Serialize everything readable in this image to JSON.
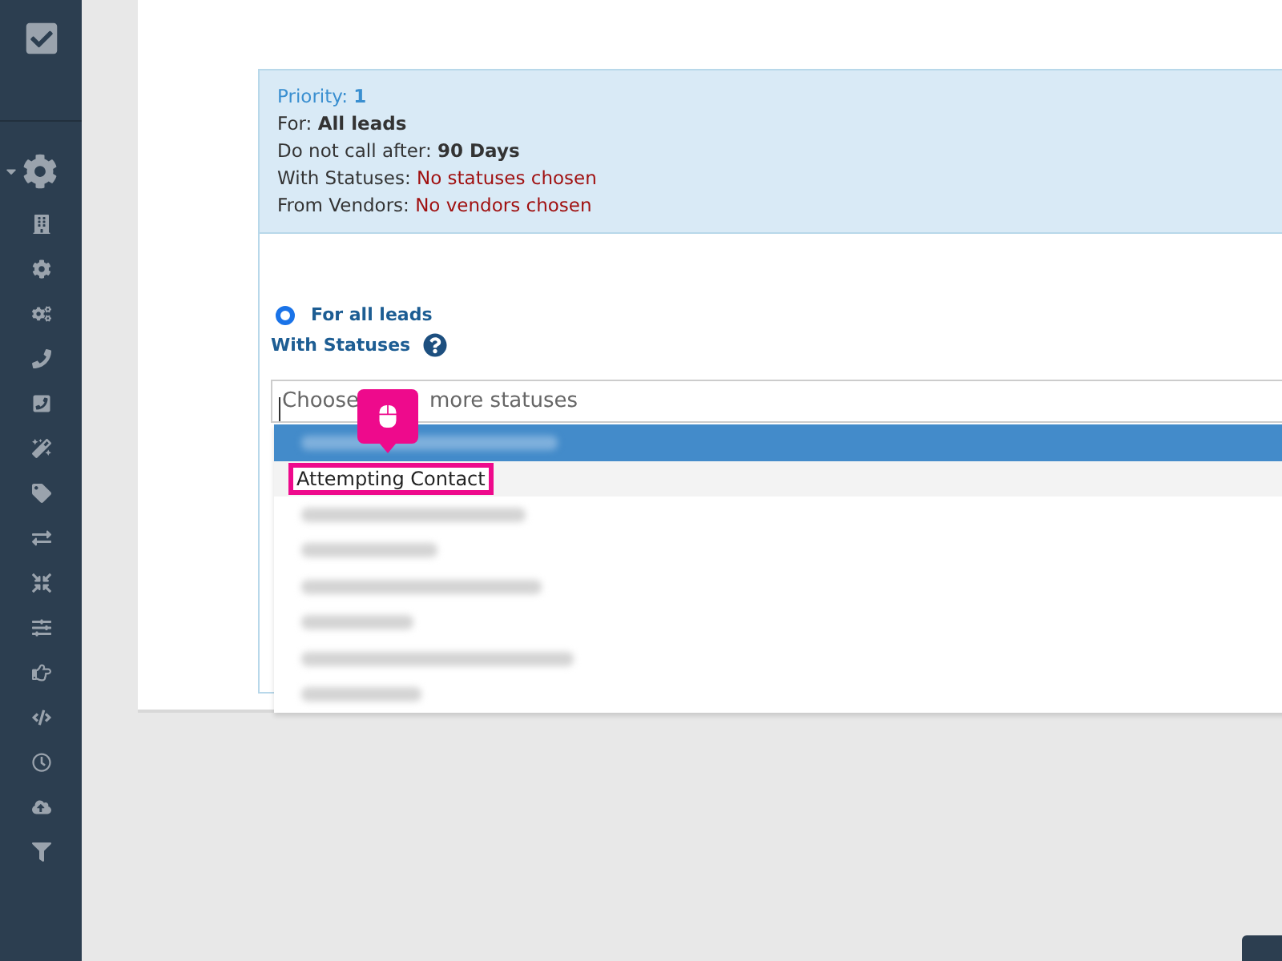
{
  "summary": {
    "priority_label": "Priority:",
    "priority": "1",
    "for_label": "For:",
    "for_value": "All leads",
    "call_label": "Do not call after:",
    "call_value": "90 Days",
    "statuses_label": "With Statuses:",
    "statuses_value": "No statuses chosen",
    "vendors_label": "From Vendors:",
    "vendors_value": "No vendors chosen"
  },
  "radio": {
    "label": "For all leads",
    "selected": true
  },
  "statuses_label": "With Statuses",
  "select": {
    "placeholder_parts": [
      "Choose",
      "more statuses"
    ]
  },
  "options": [
    {
      "kind": "blurred",
      "highlighted": true,
      "hovered": false
    },
    {
      "kind": "text",
      "label": "Attempting Contact",
      "highlighted": false,
      "hovered": true
    },
    {
      "kind": "blurred",
      "highlighted": false,
      "hovered": false
    },
    {
      "kind": "blurred",
      "highlighted": false,
      "hovered": false
    },
    {
      "kind": "blurred",
      "highlighted": false,
      "hovered": false
    },
    {
      "kind": "blurred",
      "highlighted": false,
      "hovered": false
    },
    {
      "kind": "blurred",
      "highlighted": false,
      "hovered": false
    },
    {
      "kind": "blurred",
      "highlighted": false,
      "hovered": false
    }
  ]
}
